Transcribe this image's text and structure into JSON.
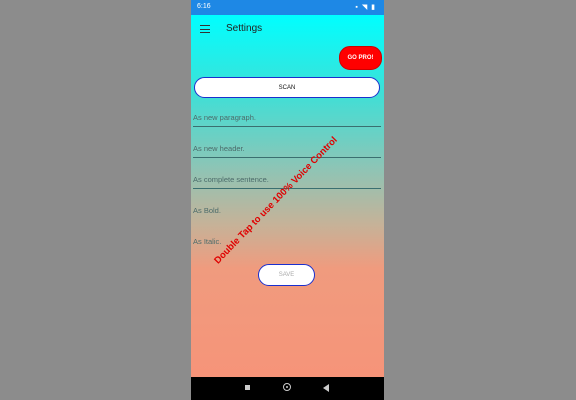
{
  "status_bar": {
    "time": "6:16",
    "icons": "▪ ◥ ▮",
    "icon_names": [
      "notification-icon",
      "wifi-icon",
      "signal-icon",
      "battery-icon"
    ]
  },
  "app_bar": {
    "title": "Settings",
    "menu_icon": "hamburger-menu-icon"
  },
  "buttons": {
    "go_pro": "GO PRO!",
    "scan": "SCAN",
    "save": "SAVE"
  },
  "fields": [
    {
      "placeholder": "As new paragraph."
    },
    {
      "placeholder": "As new header."
    },
    {
      "placeholder": "As complete sentence."
    },
    {
      "placeholder": "As Bold."
    },
    {
      "placeholder": "As Italic."
    }
  ],
  "overlay_text": "Double Tap to use 100% Voice Control",
  "colors": {
    "status_bar": "#1e88e5",
    "gradient_top": "#00ffff",
    "gradient_bottom": "#f69479",
    "go_pro_bg": "#ff0000",
    "button_border": "#1a2fcf",
    "overlay_text": "#e00000"
  },
  "nav_bar": {
    "icons": [
      "recent-apps-icon",
      "home-icon",
      "back-icon"
    ]
  }
}
